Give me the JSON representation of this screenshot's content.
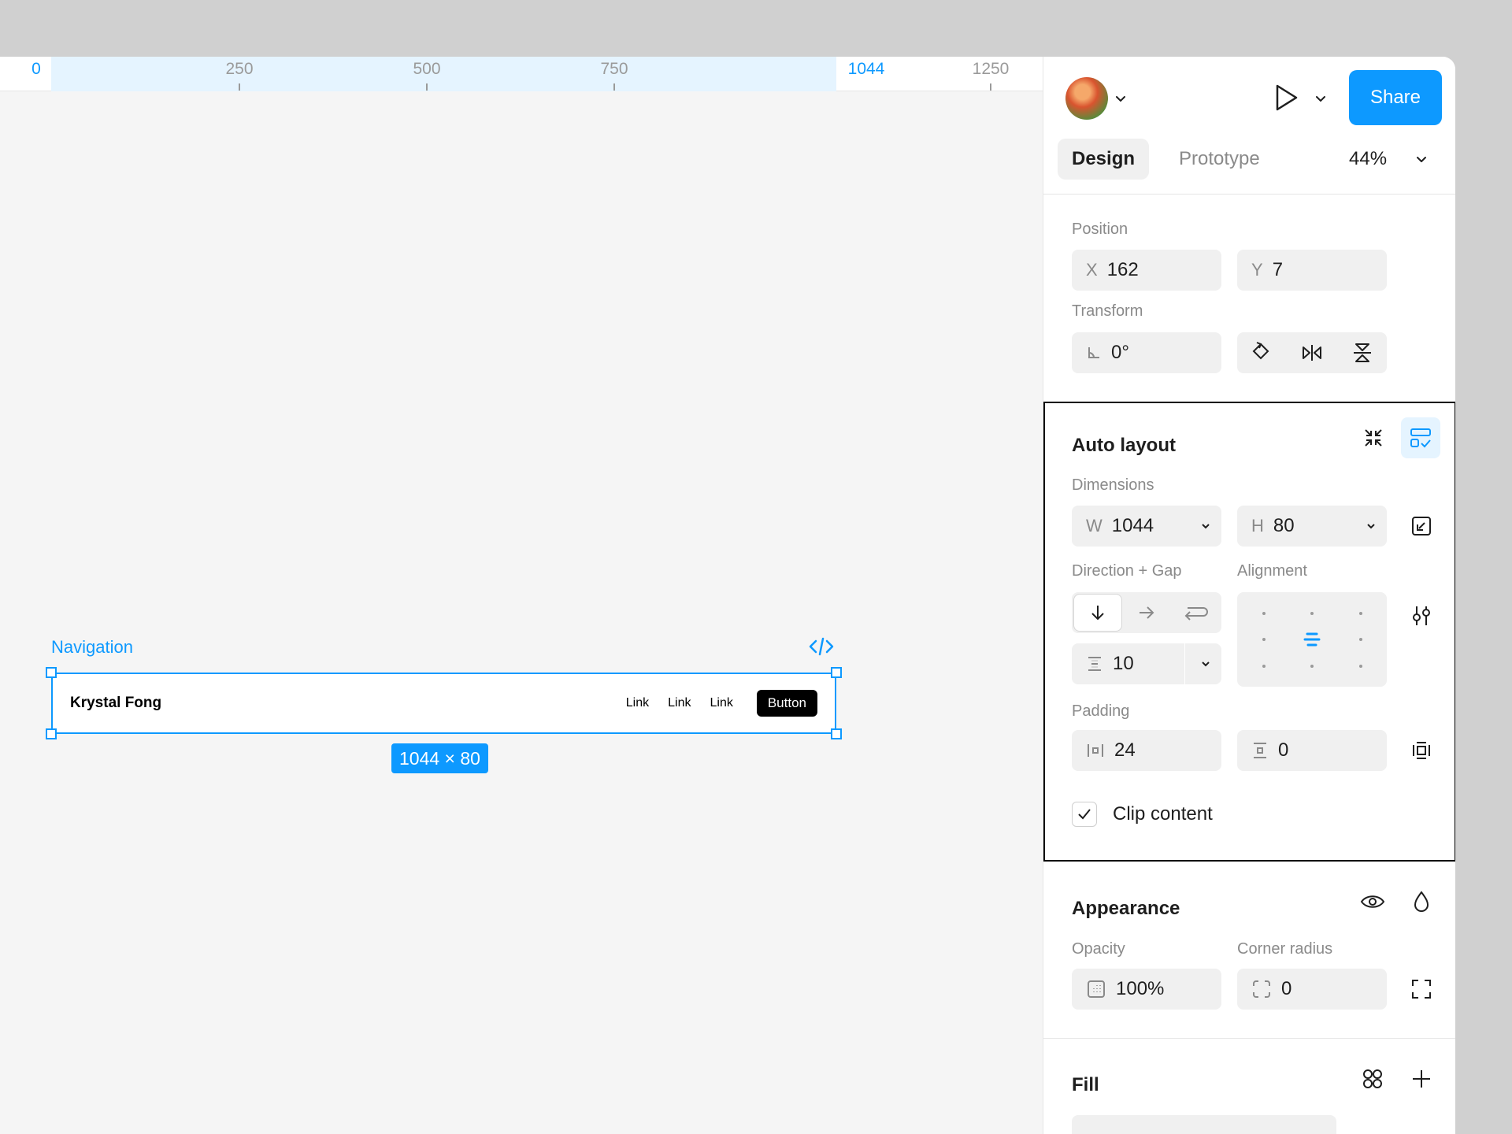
{
  "ruler": {
    "ticks": [
      "0",
      "250",
      "500",
      "750",
      "1044",
      "1250"
    ]
  },
  "canvas": {
    "frame_label": "Navigation",
    "nav": {
      "brand": "Krystal Fong",
      "links": [
        "Link",
        "Link",
        "Link"
      ],
      "button": "Button"
    },
    "size_badge": "1044 × 80"
  },
  "header": {
    "share_label": "Share",
    "tabs": [
      "Design",
      "Prototype"
    ],
    "zoom": "44%"
  },
  "position": {
    "title": "Position",
    "x_prefix": "X",
    "x": "162",
    "y_prefix": "Y",
    "y": "7"
  },
  "transform": {
    "title": "Transform",
    "rotation": "0°"
  },
  "auto_layout": {
    "title": "Auto layout",
    "dimensions_label": "Dimensions",
    "w_prefix": "W",
    "w": "1044",
    "h_prefix": "H",
    "h": "80",
    "direction_label": "Direction + Gap",
    "alignment_label": "Alignment",
    "gap": "10",
    "padding_label": "Padding",
    "padding_h": "24",
    "padding_v": "0",
    "clip_label": "Clip content",
    "clip_checked": true
  },
  "appearance": {
    "title": "Appearance",
    "opacity_label": "Opacity",
    "opacity": "100%",
    "radius_label": "Corner radius",
    "radius": "0"
  },
  "fill": {
    "title": "Fill"
  },
  "colors": {
    "accent": "#0d99ff",
    "canvas": "#f5f5f5",
    "field": "#f0f0f0"
  }
}
